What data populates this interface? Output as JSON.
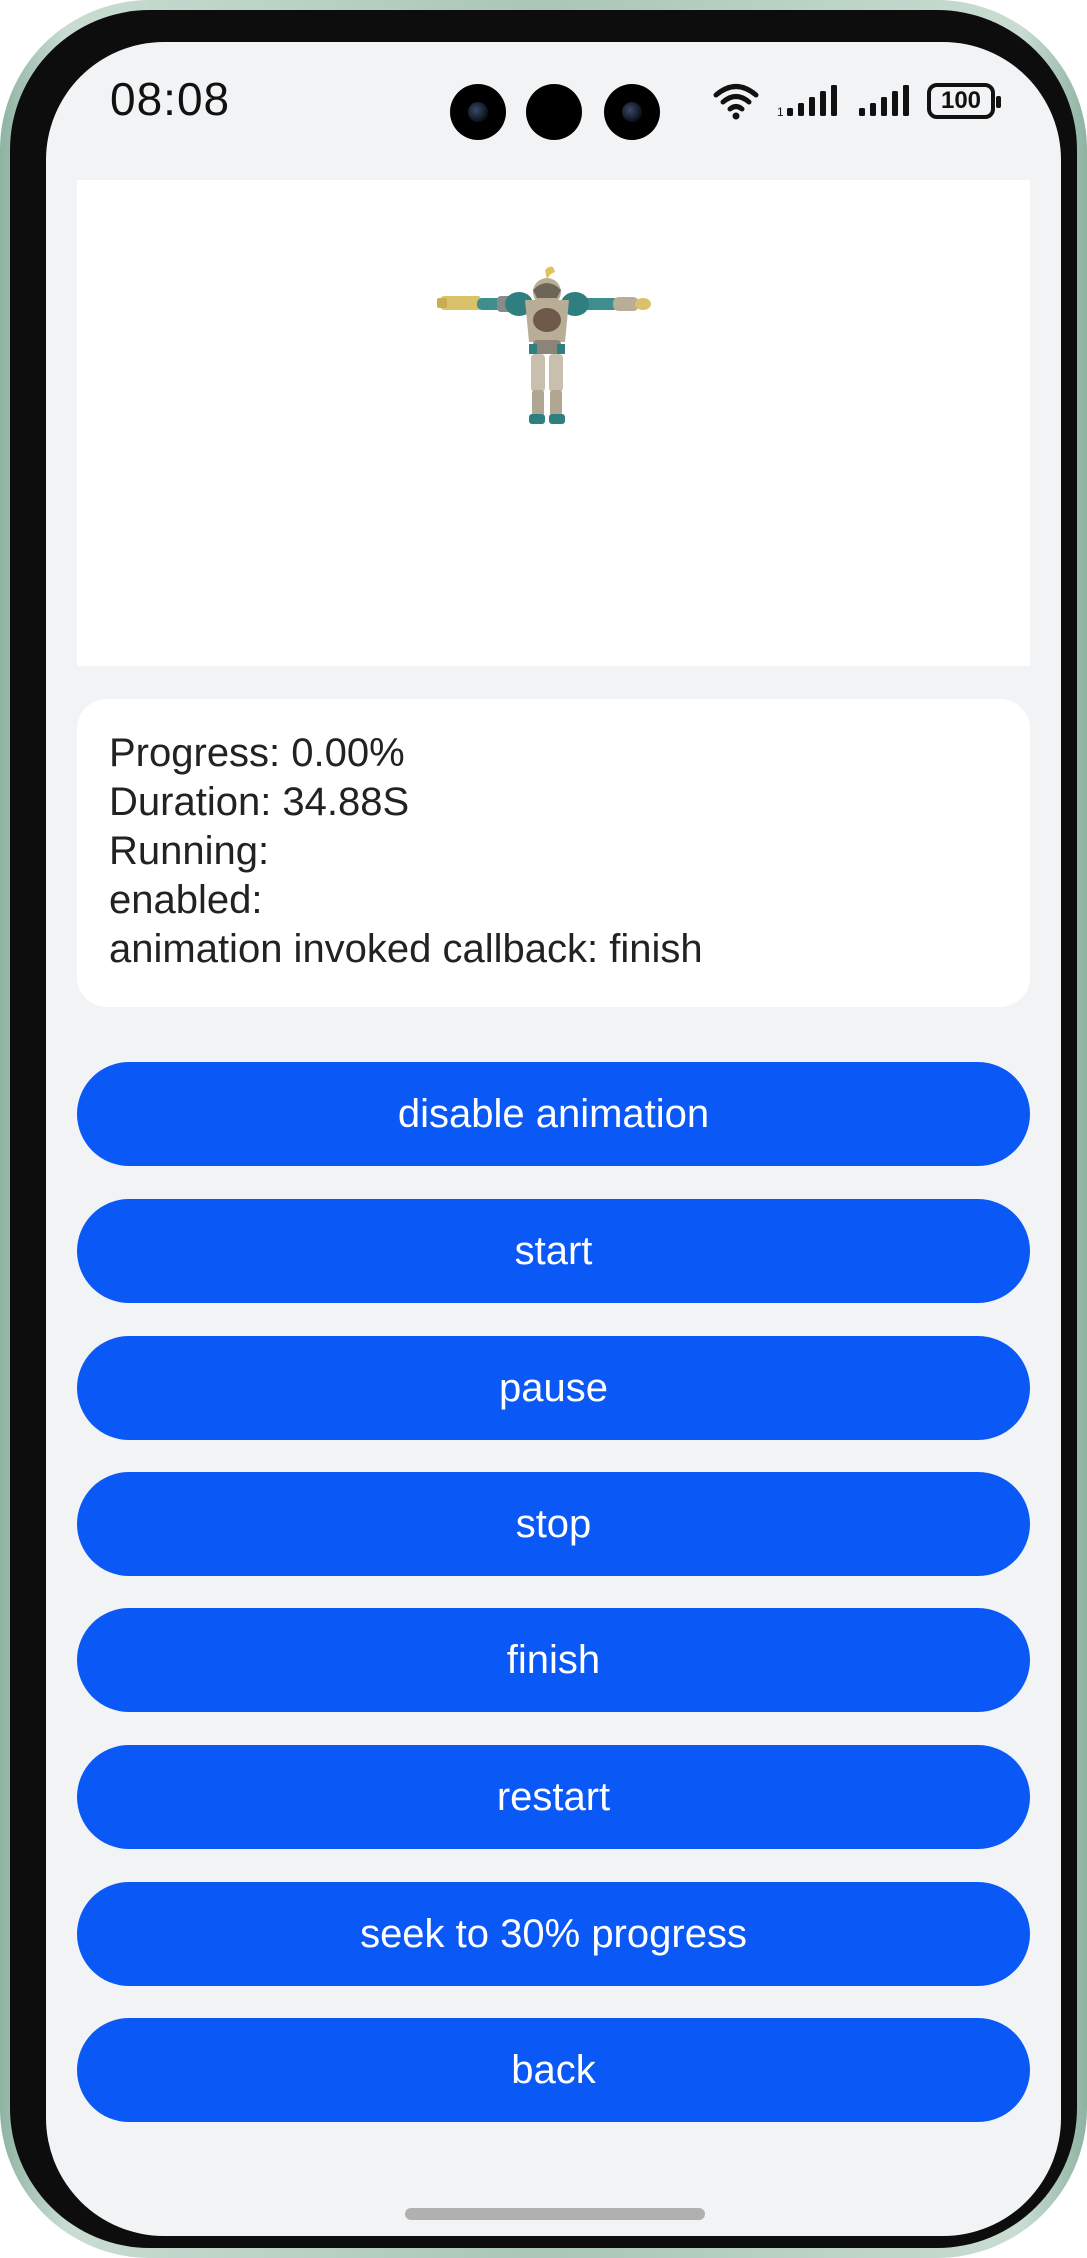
{
  "status_bar": {
    "time": "08:08",
    "battery": "100",
    "icons": [
      "wifi-icon",
      "signal-icon",
      "signal-icon",
      "battery-icon"
    ]
  },
  "model_view": {
    "icon": "robot-model-figure"
  },
  "info": {
    "progress": "Progress: 0.00%",
    "duration": "Duration: 34.88S",
    "running": "Running:",
    "enabled": "enabled:",
    "callback": "animation invoked callback: finish"
  },
  "buttons": {
    "disable": "disable animation",
    "start": "start",
    "pause": "pause",
    "stop": "stop",
    "finish": "finish",
    "restart": "restart",
    "seek": "seek to 30% progress",
    "back": "back"
  },
  "colors": {
    "accent": "#0a59f7",
    "background": "#f1f3f5",
    "card": "#ffffff"
  }
}
